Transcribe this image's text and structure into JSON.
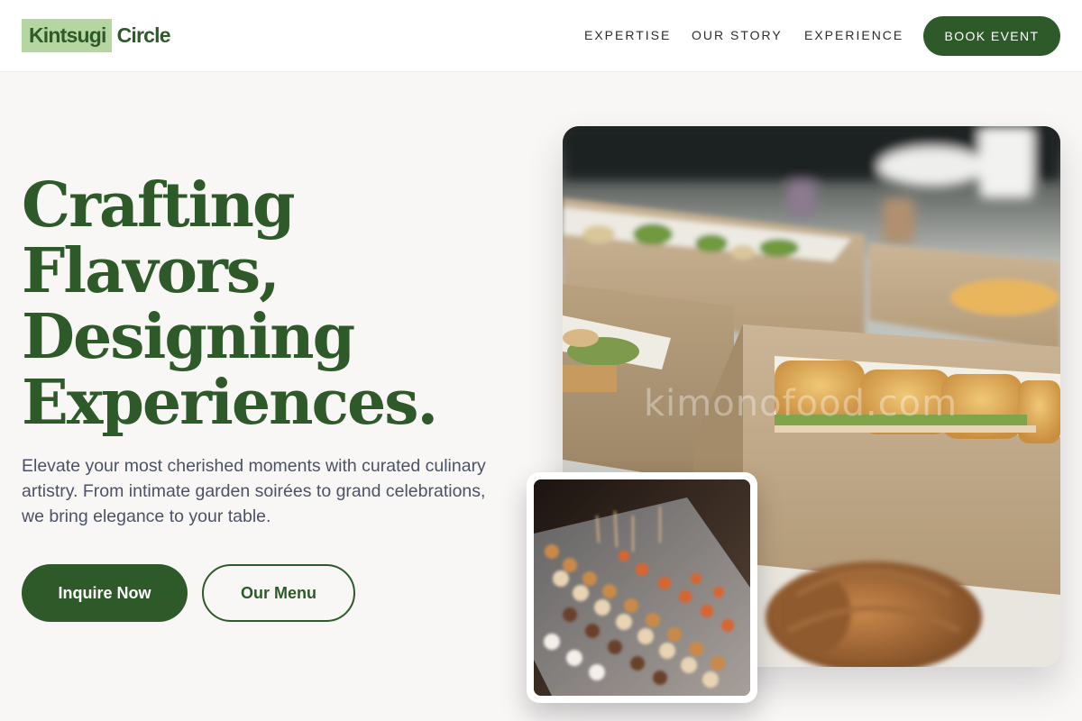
{
  "header": {
    "logo_mark": "Kintsugi",
    "logo_word": "Circle",
    "nav": [
      "EXPERTISE",
      "OUR STORY",
      "EXPERIENCE"
    ],
    "cta": "BOOK EVENT"
  },
  "hero": {
    "headline_lines": [
      "Crafting",
      "Flavors,",
      "Designing",
      "Experiences."
    ],
    "lead": "Elevate your most cherished moments with curated culinary artistry. From intimate garden soirées to grand celebrations, we bring elegance to your table.",
    "primary_button": "Inquire Now",
    "secondary_button": "Our Menu"
  },
  "images": {
    "main_photo": "boxed-catering-sandwiches",
    "main_watermark": "kimonofood.com",
    "inset_photo": "dessert-buffet-cups"
  },
  "colors": {
    "brand_green": "#2e5a2a",
    "logo_highlight": "#b5d6a0",
    "page_bg": "#f9f6f6",
    "body_text": "#4a5366"
  }
}
